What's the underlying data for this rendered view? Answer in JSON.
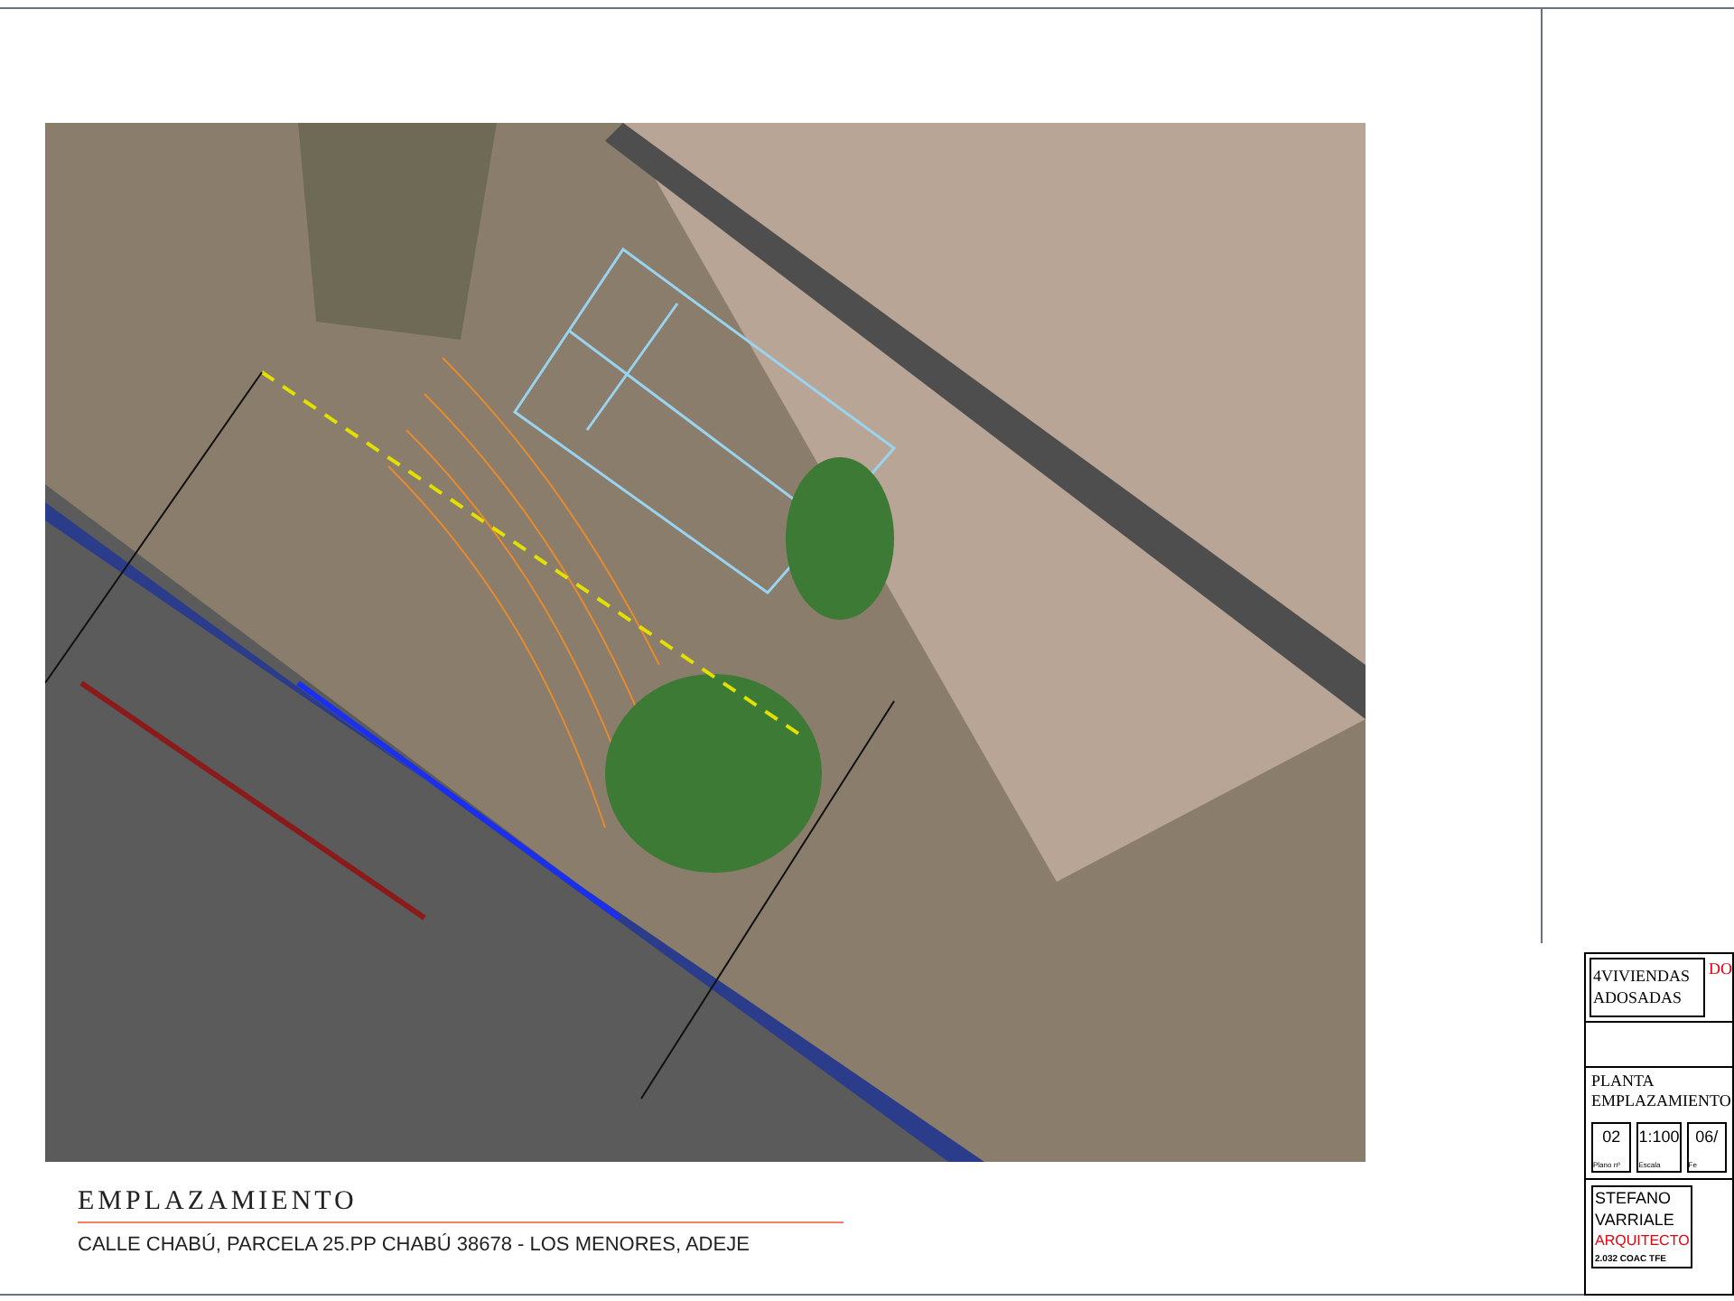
{
  "drawing": {
    "title": "EMPLAZAMIENTO",
    "address": "CALLE CHABÚ, PARCELA 25.PP CHABÚ  38678 - LOS MENORES, ADEJE"
  },
  "title_block": {
    "project": "4VIVIENDAS ADOSADAS",
    "corner_label": "DO",
    "sheet_title": "PLANTA EMPLAZAMIENTO",
    "fields": [
      {
        "value": "02",
        "label": "Plano nº"
      },
      {
        "value": "1:100",
        "label": "Escala"
      },
      {
        "value": "06/",
        "label": "Fe"
      }
    ],
    "architect": "STEFANO VARRIALE",
    "role": "ARQUITECTO",
    "registration": "2.032 COAC TFE"
  }
}
